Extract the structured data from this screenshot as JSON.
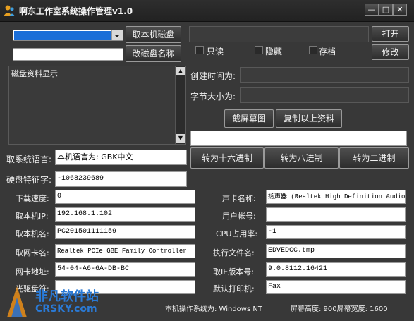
{
  "window": {
    "title": "啊东工作室系统操作管理v1.0",
    "min_glyph": "—",
    "max_glyph": "□",
    "close_glyph": "✕"
  },
  "disk": {
    "get_disk_button": "取本机磁盘",
    "rename_button": "改磁盘名称",
    "rename_value": "",
    "info_label": "磁盘资料显示"
  },
  "file": {
    "open_button": "打开",
    "modify_button": "修改",
    "readonly_label": "只读",
    "hidden_label": "隐藏",
    "archive_label": "存档",
    "created_label": "创建时间为:",
    "size_label": "字节大小为:"
  },
  "actions": {
    "screenshot_button": "截屏幕图",
    "copy_button": "复制以上资料",
    "hex_button": "转为十六进制",
    "oct_button": "转为八进制",
    "bin_button": "转为二进制"
  },
  "left_fields": {
    "language_label": "取系统语言:",
    "language_value": "本机语言为: GBK中文",
    "disk_serial_label": "硬盘特征字:",
    "disk_serial_value": "-1068239689",
    "download_speed_label": "下载速度:",
    "download_speed_value": "0",
    "ip_label": "取本机IP:",
    "ip_value": "192.168.1.102",
    "hostname_label": "取本机名:",
    "hostname_value": "PC201501111159",
    "nic_name_label": "取网卡名:",
    "nic_name_value": "Realtek PCIe GBE Family Controller",
    "mac_label": "网卡地址:",
    "mac_value": "54-04-A6-6A-DB-BC",
    "drive_label": "光驱盘符:",
    "drive_value": ""
  },
  "right_fields": {
    "sound_label": "声卡名称:",
    "sound_value": "扬声器 (Realtek High Definition Audio)",
    "user_label": "用户帐号:",
    "user_value": "",
    "cpu_label": "CPU占用率:",
    "cpu_value": "-1",
    "exe_label": "执行文件名:",
    "exe_value": "EDVEDCC.tmp",
    "ie_label": "取IE版本号:",
    "ie_value": "9.0.8112.16421",
    "printer_label": "默认打印机:",
    "printer_value": "Fax"
  },
  "status": {
    "os_text": "本机操作系统为:  Windows NT",
    "screen_text": "屏幕高度: 900屏幕宽度: 1600"
  },
  "watermark": {
    "line1": "非凡软件站",
    "line2": "CRSKY.com"
  }
}
